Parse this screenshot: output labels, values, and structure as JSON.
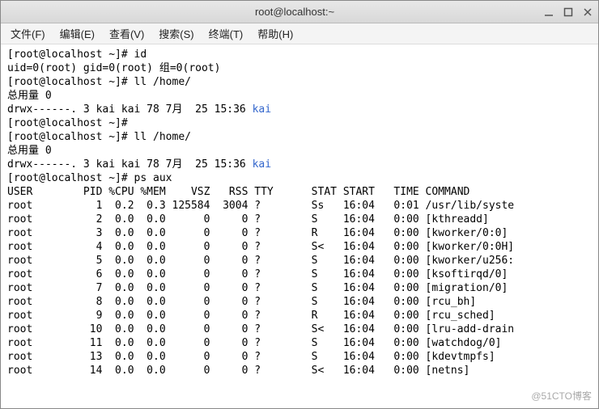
{
  "window": {
    "title": "root@localhost:~"
  },
  "menu": {
    "items": [
      {
        "label": "文件(F)"
      },
      {
        "label": "编辑(E)"
      },
      {
        "label": "查看(V)"
      },
      {
        "label": "搜索(S)"
      },
      {
        "label": "终端(T)"
      },
      {
        "label": "帮助(H)"
      }
    ]
  },
  "term": {
    "prompt1": "[root@localhost ~]# id",
    "idout": "uid=0(root) gid=0(root) 组=0(root)",
    "prompt2": "[root@localhost ~]# ll /home/",
    "total1": "总用量 0",
    "drwx1a": "drwx------. 3 kai kai 78 7月  25 15:36 ",
    "drwx1b": "kai",
    "prompt3": "[root@localhost ~]# ",
    "prompt4": "[root@localhost ~]# ll /home/",
    "total2": "总用量 0",
    "drwx2a": "drwx------. 3 kai kai 78 7月  25 15:36 ",
    "drwx2b": "kai",
    "prompt5": "[root@localhost ~]# ps aux",
    "pshdr": "USER        PID %CPU %MEM    VSZ   RSS TTY      STAT START   TIME COMMAND",
    "ps": [
      "root          1  0.2  0.3 125584  3004 ?        Ss   16:04   0:01 /usr/lib/syste",
      "root          2  0.0  0.0      0     0 ?        S    16:04   0:00 [kthreadd]",
      "root          3  0.0  0.0      0     0 ?        R    16:04   0:00 [kworker/0:0]",
      "root          4  0.0  0.0      0     0 ?        S<   16:04   0:00 [kworker/0:0H]",
      "root          5  0.0  0.0      0     0 ?        S    16:04   0:00 [kworker/u256:",
      "root          6  0.0  0.0      0     0 ?        S    16:04   0:00 [ksoftirqd/0]",
      "root          7  0.0  0.0      0     0 ?        S    16:04   0:00 [migration/0]",
      "root          8  0.0  0.0      0     0 ?        S    16:04   0:00 [rcu_bh]",
      "root          9  0.0  0.0      0     0 ?        R    16:04   0:00 [rcu_sched]",
      "root         10  0.0  0.0      0     0 ?        S<   16:04   0:00 [lru-add-drain",
      "root         11  0.0  0.0      0     0 ?        S    16:04   0:00 [watchdog/0]",
      "root         13  0.0  0.0      0     0 ?        S    16:04   0:00 [kdevtmpfs]",
      "root         14  0.0  0.0      0     0 ?        S<   16:04   0:00 [netns]"
    ]
  },
  "watermark": "@51CTO博客"
}
